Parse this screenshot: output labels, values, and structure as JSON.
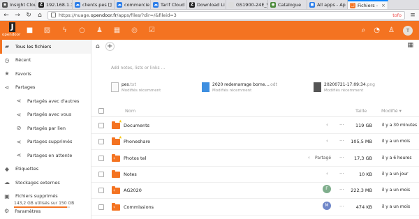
{
  "browser": {
    "tabs": [
      {
        "label": "Insight Cloud",
        "color": "#555555",
        "glyph": "▪",
        "active": false
      },
      {
        "label": "192.168.1.1",
        "color": "#222222",
        "glyph": "Z",
        "active": false
      },
      {
        "label": "clients.pes []",
        "color": "#2b7de9",
        "glyph": "☁",
        "active": false
      },
      {
        "label": "commercie",
        "color": "#2b7de9",
        "glyph": "☁",
        "active": false
      },
      {
        "label": "Tarif Cloud",
        "color": "#2b7de9",
        "glyph": "☁",
        "active": false
      },
      {
        "label": "Download Li",
        "color": "#222222",
        "glyph": "Z",
        "active": false
      },
      {
        "label": "GS1900-24E_V2",
        "color": "#dddddd",
        "glyph": "",
        "active": false
      },
      {
        "label": "Catalogue",
        "color": "#4a8a3a",
        "glyph": "◉",
        "active": false
      },
      {
        "label": "All apps - Ap",
        "color": "#2b7de9",
        "glyph": "◼",
        "active": false
      },
      {
        "label": "Fichiers -",
        "color": "#f47321",
        "glyph": "□",
        "active": true
      }
    ],
    "url_prefix": "https://nuage.",
    "url_domain": "opendoor.fr",
    "url_suffix": "/apps/files/?dir=/&fileid=3",
    "url_badge": "tofo"
  },
  "header": {
    "logo_letter": "J",
    "logo_word": "opendoor"
  },
  "sidebar": {
    "items": [
      {
        "label": "Tous les fichiers",
        "icon": "▰"
      },
      {
        "label": "Récent",
        "icon": "◷"
      },
      {
        "label": "Favoris",
        "icon": "★"
      },
      {
        "label": "Partages",
        "icon": "⋖"
      },
      {
        "label": "Partagés avec d'autres",
        "icon": "⋖"
      },
      {
        "label": "Partagés avec vous",
        "icon": "⋖"
      },
      {
        "label": "Partagés par lien",
        "icon": "⊘"
      },
      {
        "label": "Partages supprimés",
        "icon": "⋖"
      },
      {
        "label": "Partages en attente",
        "icon": "⋖"
      },
      {
        "label": "Étiquettes",
        "icon": "◆"
      },
      {
        "label": "Stockages externes",
        "icon": "☁"
      },
      {
        "label": "Fichiers supprimés",
        "icon": "▣"
      }
    ],
    "quota": "143,2 GB utilisés sur 150 GB",
    "quota_fraction": 0.955,
    "settings": "Paramètres"
  },
  "main": {
    "notes_placeholder": "Add notes, lists or links …",
    "recent": [
      {
        "name": "pes",
        "ext": ".txt",
        "sub": "Modifiés récemment",
        "kind": "txt"
      },
      {
        "name": "2020 redemarrage borne...",
        "ext": ".odt",
        "sub": "Modifiés récemment",
        "kind": "doc"
      },
      {
        "name": "20200721-17:09:34",
        "ext": ".png",
        "sub": "Modifiés récemment",
        "kind": "img"
      }
    ],
    "col_name": "Nom",
    "col_size": "Taille",
    "col_modified": "Modifié ▾",
    "shared_label": "Partagé",
    "files": [
      {
        "name": "Documents",
        "size": "119 GB",
        "modified": "il y a 30 minutes",
        "star": true,
        "share": false,
        "shared": false,
        "avatar": ""
      },
      {
        "name": "Phoneshare",
        "size": "105,5 MB",
        "modified": "il y a un mois",
        "star": true,
        "share": false,
        "shared": false,
        "avatar": ""
      },
      {
        "name": "Photos tel",
        "size": "17,3 GB",
        "modified": "il y a 6 heures",
        "star": false,
        "share": true,
        "shared": true,
        "avatar": ""
      },
      {
        "name": "Notes",
        "size": "10 KB",
        "modified": "il y a un jour",
        "star": false,
        "share": false,
        "shared": false,
        "avatar": ""
      },
      {
        "name": "AG2020",
        "size": "222,3 MB",
        "modified": "il y a un mois",
        "star": false,
        "share": true,
        "shared": false,
        "avatar": "F"
      },
      {
        "name": "Commissions",
        "size": "474 KB",
        "modified": "il y a un mois",
        "star": false,
        "share": true,
        "shared": false,
        "avatar": "M"
      }
    ]
  },
  "colors": {
    "brand": "#f47321",
    "avatar_f": "#7fae8c",
    "avatar_m": "#6f87c9"
  }
}
